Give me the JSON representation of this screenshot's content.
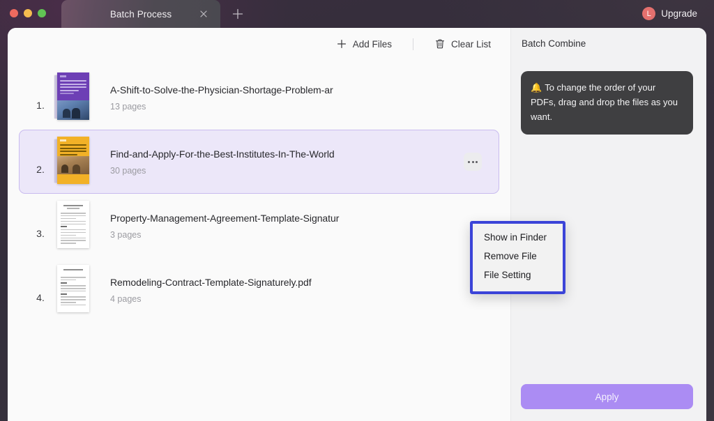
{
  "window": {
    "traffic_lights": [
      "close",
      "minimize",
      "zoom"
    ],
    "tab": {
      "title": "Batch Process",
      "close_icon": "close-icon",
      "new_tab_icon": "plus-icon"
    },
    "upgrade": {
      "badge_letter": "L",
      "label": "Upgrade",
      "badge_color": "#e4706e"
    }
  },
  "toolbar": {
    "add_files_label": "Add Files",
    "add_files_icon": "plus-icon",
    "clear_list_label": "Clear List",
    "clear_list_icon": "trash-icon"
  },
  "file_list": [
    {
      "index": "1.",
      "name": "A-Shift-to-Solve-the-Physician-Shortage-Problem-ar",
      "pages": "13 pages",
      "thumb": "cover-purple",
      "selected": false
    },
    {
      "index": "2.",
      "name": "Find-and-Apply-For-the-Best-Institutes-In-The-World",
      "pages": "30 pages",
      "thumb": "cover-orange",
      "selected": true
    },
    {
      "index": "3.",
      "name": "Property-Management-Agreement-Template-Signatur",
      "pages": "3 pages",
      "thumb": "cover-doc",
      "selected": false
    },
    {
      "index": "4.",
      "name": "Remodeling-Contract-Template-Signaturely.pdf",
      "pages": "4 pages",
      "thumb": "cover-doc",
      "selected": false
    }
  ],
  "context_menu": {
    "items": [
      {
        "label": "Show in Finder"
      },
      {
        "label": "Remove File"
      },
      {
        "label": "File Setting"
      }
    ],
    "highlight_color": "#3b44d8"
  },
  "right_panel": {
    "title": "Batch Combine",
    "tip": {
      "icon": "🔔",
      "text": "To change the order of your PDFs, drag and drop the files as you want."
    },
    "apply_label": "Apply",
    "apply_color": "#ab8cf3"
  }
}
